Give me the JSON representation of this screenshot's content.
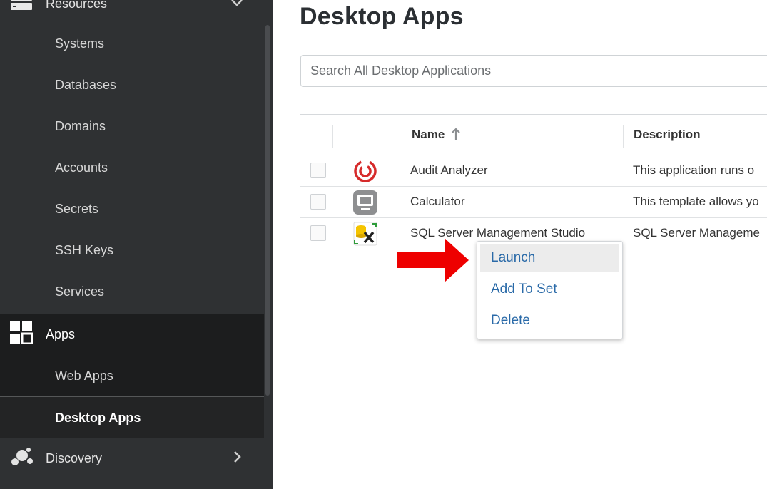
{
  "sidebar": {
    "resources_label": "Resources",
    "resource_items": [
      {
        "label": "Systems"
      },
      {
        "label": "Databases"
      },
      {
        "label": "Domains"
      },
      {
        "label": "Accounts"
      },
      {
        "label": "Secrets"
      },
      {
        "label": "SSH Keys"
      },
      {
        "label": "Services"
      }
    ],
    "apps_label": "Apps",
    "apps_items": [
      {
        "label": "Web Apps"
      },
      {
        "label": "Desktop Apps",
        "active": true
      }
    ],
    "discovery_label": "Discovery"
  },
  "main": {
    "title": "Desktop Apps",
    "search_placeholder": "Search All Desktop Applications",
    "table": {
      "columns": {
        "name": "Name",
        "description": "Description"
      },
      "rows": [
        {
          "icon": "audit-analyzer-icon",
          "name": "Audit Analyzer",
          "description": "This application runs o"
        },
        {
          "icon": "calculator-icon",
          "name": "Calculator",
          "description": "This template allows yo"
        },
        {
          "icon": "sql-server-icon",
          "name": "SQL Server Management Studio",
          "description": "SQL Server Manageme"
        }
      ]
    }
  },
  "context_menu": {
    "items": [
      {
        "label": "Launch",
        "highlighted": true
      },
      {
        "label": "Add To Set"
      },
      {
        "label": "Delete"
      }
    ]
  },
  "colors": {
    "sidebar_bg": "#2f3133",
    "menu_link": "#2a6aa8",
    "annotation_arrow": "#ee0000"
  }
}
